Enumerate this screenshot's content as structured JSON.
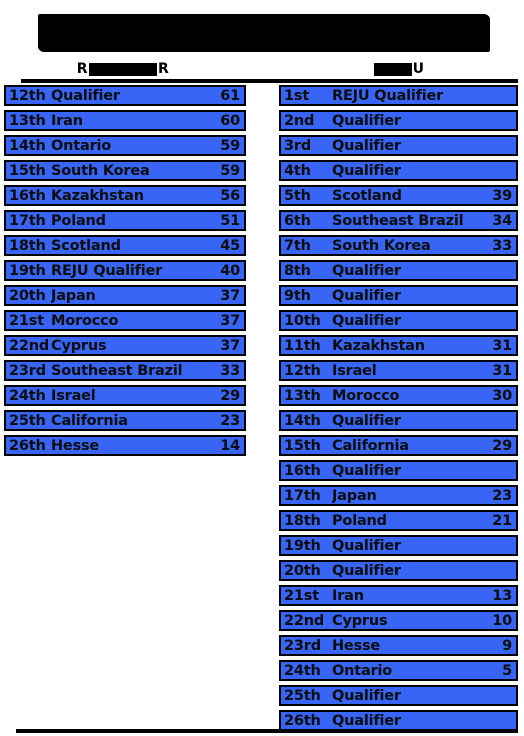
{
  "title": {
    "text": "",
    "redacted": true,
    "note": "title bar fully blacked out"
  },
  "headers": {
    "left": {
      "prefix": "R",
      "suffix": "R",
      "redacted": true
    },
    "right": {
      "prefix": "",
      "suffix": "U",
      "redacted": true
    }
  },
  "tables": {
    "left": {
      "rows": [
        {
          "rank": "12th",
          "name": "Qualifier",
          "value": "61"
        },
        {
          "rank": "13th",
          "name": "Iran",
          "value": "60"
        },
        {
          "rank": "14th",
          "name": "Ontario",
          "value": "59"
        },
        {
          "rank": "15th",
          "name": "South Korea",
          "value": "59"
        },
        {
          "rank": "16th",
          "name": "Kazakhstan",
          "value": "56"
        },
        {
          "rank": "17th",
          "name": "Poland",
          "value": "51"
        },
        {
          "rank": "18th",
          "name": "Scotland",
          "value": "45"
        },
        {
          "rank": "19th",
          "name": "REJU Qualifier",
          "value": "40"
        },
        {
          "rank": "20th",
          "name": "Japan",
          "value": "37"
        },
        {
          "rank": "21st",
          "name": "Morocco",
          "value": "37"
        },
        {
          "rank": "22nd",
          "name": "Cyprus",
          "value": "37"
        },
        {
          "rank": "23rd",
          "name": "Southeast Brazil",
          "value": "33"
        },
        {
          "rank": "24th",
          "name": "Israel",
          "value": "29"
        },
        {
          "rank": "25th",
          "name": "California",
          "value": "23"
        },
        {
          "rank": "26th",
          "name": "Hesse",
          "value": "14"
        }
      ]
    },
    "right": {
      "rows": [
        {
          "rank": "1st",
          "name": "REJU Qualifier",
          "value": ""
        },
        {
          "rank": "2nd",
          "name": "Qualifier",
          "value": ""
        },
        {
          "rank": "3rd",
          "name": "Qualifier",
          "value": ""
        },
        {
          "rank": "4th",
          "name": "Qualifier",
          "value": ""
        },
        {
          "rank": "5th",
          "name": "Scotland",
          "value": "39"
        },
        {
          "rank": "6th",
          "name": "Southeast Brazil",
          "value": "34"
        },
        {
          "rank": "7th",
          "name": "South Korea",
          "value": "33"
        },
        {
          "rank": "8th",
          "name": "Qualifier",
          "value": ""
        },
        {
          "rank": "9th",
          "name": "Qualifier",
          "value": ""
        },
        {
          "rank": "10th",
          "name": "Qualifier",
          "value": ""
        },
        {
          "rank": "11th",
          "name": "Kazakhstan",
          "value": "31"
        },
        {
          "rank": "12th",
          "name": "Israel",
          "value": "31"
        },
        {
          "rank": "13th",
          "name": "Morocco",
          "value": "30"
        },
        {
          "rank": "14th",
          "name": "Qualifier",
          "value": ""
        },
        {
          "rank": "15th",
          "name": "California",
          "value": "29"
        },
        {
          "rank": "16th",
          "name": "Qualifier",
          "value": ""
        },
        {
          "rank": "17th",
          "name": "Japan",
          "value": "23"
        },
        {
          "rank": "18th",
          "name": "Poland",
          "value": "21"
        },
        {
          "rank": "19th",
          "name": "Qualifier",
          "value": ""
        },
        {
          "rank": "20th",
          "name": "Qualifier",
          "value": ""
        },
        {
          "rank": "21st",
          "name": "Iran",
          "value": "13"
        },
        {
          "rank": "22nd",
          "name": "Cyprus",
          "value": "10"
        },
        {
          "rank": "23rd",
          "name": "Hesse",
          "value": "9"
        },
        {
          "rank": "24th",
          "name": "Ontario",
          "value": "5"
        },
        {
          "rank": "25th",
          "name": "Qualifier",
          "value": ""
        },
        {
          "rank": "26th",
          "name": "Qualifier",
          "value": ""
        }
      ]
    }
  },
  "colors": {
    "row_fill": "#3865f5",
    "row_border": "#000000",
    "text": "#0d0d0d",
    "background": "#ffffff",
    "redaction": "#000000"
  }
}
